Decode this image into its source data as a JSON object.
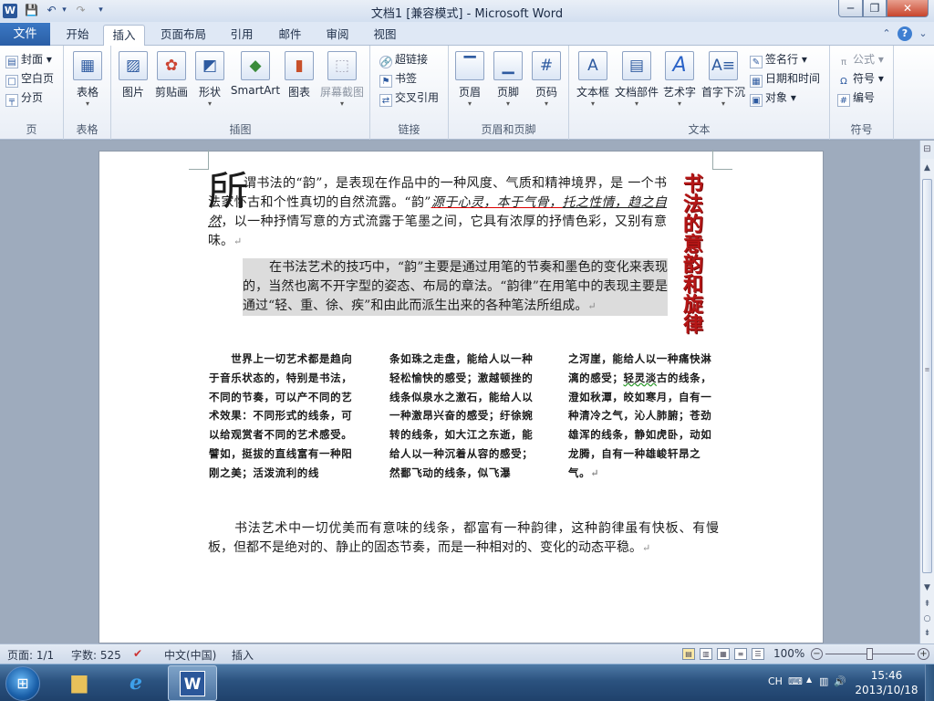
{
  "window": {
    "title": "文档1 [兼容模式] - Microsoft Word",
    "minimize": "─",
    "restore": "❐",
    "close": "✕"
  },
  "quick_access": {
    "save": "💾",
    "undo": "↶",
    "redo": "↷",
    "more": "▾"
  },
  "tabs": {
    "file": "文件",
    "items": [
      "开始",
      "插入",
      "页面布局",
      "引用",
      "邮件",
      "审阅",
      "视图"
    ],
    "active": "插入"
  },
  "ribbon": {
    "page": {
      "label": "页",
      "cover": "封面",
      "blank": "空白页",
      "break": "分页"
    },
    "table": {
      "label": "表格",
      "button": "表格"
    },
    "illustrations": {
      "label": "插图",
      "picture": "图片",
      "clipart": "剪贴画",
      "shapes": "形状",
      "smartart": "SmartArt",
      "chart": "图表",
      "screenshot": "屏幕截图"
    },
    "links": {
      "label": "链接",
      "hyperlink": "超链接",
      "bookmark": "书签",
      "crossref": "交叉引用"
    },
    "header_footer": {
      "label": "页眉和页脚",
      "header": "页眉",
      "footer": "页脚",
      "page_number": "页码"
    },
    "text": {
      "label": "文本",
      "textbox": "文本框",
      "quickparts": "文档部件",
      "wordart": "艺术字",
      "dropcap": "首字下沉",
      "signature": "签名行",
      "datetime": "日期和时间",
      "object": "对象"
    },
    "symbols": {
      "label": "符号",
      "equation": "公式",
      "symbol": "符号",
      "number": "编号"
    }
  },
  "document": {
    "dropcap": "所",
    "p1_a": "谓书法的“韵”，是表现在作品中的一种风度、气质和精神境界，是",
    "p1_b": "一个书法家怀古和个性真切的自然流露。“韵”",
    "p1_u1": "源于心灵，本于气骨，",
    "p1_u2": "托之性情，趋之自然",
    "p1_c": "，以一种抒情写意的方式流露于笔墨之间，它具有浓厚的抒情色彩，又别有意味。",
    "p2": "在书法艺术的技巧中，“韵”主要是通过用笔的节奏和墨色的变化来表现的，当然也离不开字型的姿态、布局的章法。“韵律”在用笔中的表现主要是通过“轻、重、徐、疾”和由此而派生出来的各种笔法所组成。",
    "vertical_title": [
      "书",
      "法",
      "的",
      "意",
      "韵",
      "和",
      "旋",
      "律"
    ],
    "col1": "　　世界上一切艺术都是趋向于音乐状态的，特别是书法，不同的节奏，可以产不同的艺术效果：不同形式的线条，可以给观赏者不同的艺术感受。譬如，挺拔的直线富有一种阳刚之美；活泼流利的线",
    "col2": "条如珠之走盘，能给人以一种轻松愉快的感受；激越顿挫的线条似泉水之激石，能给人以一种激昂兴奋的感受；纡徐婉转的线条，如大江之东逝，能给人以一种沉着从容的感受；然鄱飞动的线条，似飞瀑",
    "col3_a": "之泻崖，能给人以一种痛快淋漓的感受；",
    "col3_w": "轻灵淡",
    "col3_b": "古的线条，澄如秋潭，皎如寒月，自有一种清冷之气，沁人肺腑；苍劲雄浑的线条，静如虎卧，动如龙腾，自有一种雄峻轩昂之气。",
    "p4": "书法艺术中一切优美而有意味的线条，都富有一种韵律，这种韵律虽有快板、有慢板，但都不是绝对的、静止的固态节奏，而是一种相对的、变化的动态平稳。",
    "pilcrow": "↵"
  },
  "status": {
    "page": "页面: 1/1",
    "words": "字数: 525",
    "lang": "中文(中国)",
    "mode": "插入",
    "zoom": "100%",
    "zoom_minus": "−",
    "zoom_plus": "+"
  },
  "taskbar": {
    "start": "⊞",
    "ie": "e",
    "word": "W",
    "lang": "CH",
    "time": "15:46",
    "date": "2013/10/18"
  },
  "colors": {
    "accent": "#2b579a",
    "title_red": "#b51616"
  }
}
